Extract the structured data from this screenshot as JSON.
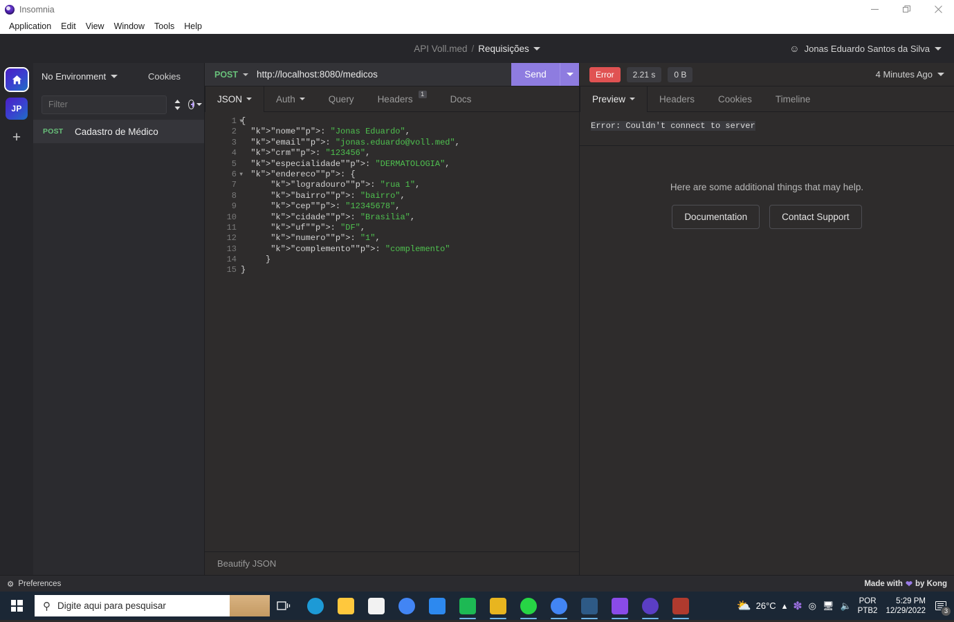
{
  "window": {
    "app_title": "Insomnia",
    "logo_icon": "insomnia-logo-icon",
    "minimize_icon": "minimize-icon",
    "maximize_icon": "maximize-icon",
    "close_icon": "close-icon"
  },
  "menubar": {
    "items": [
      {
        "label": "Application"
      },
      {
        "label": "Edit"
      },
      {
        "label": "View"
      },
      {
        "label": "Window"
      },
      {
        "label": "Tools"
      },
      {
        "label": "Help"
      }
    ]
  },
  "header": {
    "workspace": "API Voll.med",
    "separator": "/",
    "collection": "Requisições",
    "collection_caret": "chevron-down-icon",
    "account_icon": "person-icon",
    "account_name": "Jonas Eduardo Santos da Silva",
    "account_caret": "chevron-down-icon"
  },
  "rail": {
    "items": [
      {
        "label": "",
        "icon": "home-icon",
        "selected": true
      },
      {
        "label": "JP",
        "icon": "workspace-avatar",
        "selected": false
      }
    ],
    "add_label": "+"
  },
  "sidebar": {
    "environment": "No Environment",
    "environment_caret": "chevron-down-icon",
    "cookies_label": "Cookies",
    "filter_placeholder": "Filter",
    "filter_value": "",
    "sort_icon": "sort-icon",
    "add_icon": "plus-circle-icon",
    "add_caret": "chevron-down-icon",
    "requests": [
      {
        "method": "POST",
        "name": "Cadastro de Médico"
      }
    ]
  },
  "request": {
    "method": "POST",
    "method_caret": "chevron-down-icon",
    "url": "http://localhost:8080/medicos",
    "send_label": "Send",
    "send_caret": "chevron-down-icon",
    "tabs": [
      {
        "label": "JSON",
        "active": true,
        "caret": "chevron-down-icon",
        "badge": ""
      },
      {
        "label": "Auth",
        "active": false,
        "caret": "chevron-down-icon",
        "badge": ""
      },
      {
        "label": "Query",
        "active": false,
        "caret": "",
        "badge": ""
      },
      {
        "label": "Headers",
        "active": false,
        "caret": "",
        "badge": "1"
      },
      {
        "label": "Docs",
        "active": false,
        "caret": "",
        "badge": ""
      }
    ],
    "body_lines": [
      {
        "n": "1",
        "fold": true,
        "text": "{"
      },
      {
        "n": "2",
        "fold": false,
        "text": "  \"nome\": \"Jonas Eduardo\","
      },
      {
        "n": "3",
        "fold": false,
        "text": "  \"email\": \"jonas.eduardo@voll.med\","
      },
      {
        "n": "4",
        "fold": false,
        "text": "  \"crm\": \"123456\","
      },
      {
        "n": "5",
        "fold": false,
        "text": "  \"especialidade\": \"DERMATOLOGIA\","
      },
      {
        "n": "6",
        "fold": true,
        "text": "  \"endereco\": {"
      },
      {
        "n": "7",
        "fold": false,
        "text": "      \"logradouro\": \"rua 1\","
      },
      {
        "n": "8",
        "fold": false,
        "text": "      \"bairro\": \"bairro\","
      },
      {
        "n": "9",
        "fold": false,
        "text": "      \"cep\": \"12345678\","
      },
      {
        "n": "10",
        "fold": false,
        "text": "      \"cidade\": \"Brasilia\","
      },
      {
        "n": "11",
        "fold": false,
        "text": "      \"uf\": \"DF\","
      },
      {
        "n": "12",
        "fold": false,
        "text": "      \"numero\": \"1\","
      },
      {
        "n": "13",
        "fold": false,
        "text": "      \"complemento\": \"complemento\""
      },
      {
        "n": "14",
        "fold": false,
        "text": "     }"
      },
      {
        "n": "15",
        "fold": false,
        "text": "}"
      }
    ],
    "beautify_label": "Beautify JSON"
  },
  "response": {
    "status_label": "Error",
    "duration": "2.21 s",
    "size": "0 B",
    "timestamp": "4 Minutes Ago",
    "timestamp_caret": "chevron-down-icon",
    "tabs": [
      {
        "label": "Preview",
        "active": true,
        "caret": "chevron-down-icon"
      },
      {
        "label": "Headers",
        "active": false,
        "caret": ""
      },
      {
        "label": "Cookies",
        "active": false,
        "caret": ""
      },
      {
        "label": "Timeline",
        "active": false,
        "caret": ""
      }
    ],
    "error_message": "Error: Couldn't connect to server",
    "help_text": "Here are some additional things that may help.",
    "help_buttons": [
      {
        "label": "Documentation"
      },
      {
        "label": "Contact Support"
      }
    ]
  },
  "statusbar": {
    "preferences_label": "Preferences",
    "preferences_icon": "gear-icon",
    "made_with_prefix": "Made with",
    "heart_icon": "heart-icon",
    "made_with_suffix": "by Kong"
  },
  "taskbar": {
    "start_icon": "windows-start-icon",
    "search_icon": "search-icon",
    "search_placeholder": "Digite aqui para pesquisar",
    "task_view_icon": "task-view-icon",
    "apps": [
      {
        "name": "microsoft-edge-icon",
        "color": "#1d9ad6",
        "open": false
      },
      {
        "name": "file-explorer-icon",
        "color": "#ffc83d",
        "open": false
      },
      {
        "name": "microsoft-store-icon",
        "color": "#f2f2f2",
        "open": false
      },
      {
        "name": "google-chrome-icon",
        "color": "#4285f4",
        "open": false
      },
      {
        "name": "mail-icon",
        "color": "#2d89ef",
        "open": false
      },
      {
        "name": "spotify-icon",
        "color": "#1db954",
        "open": true
      },
      {
        "name": "chart-app-icon",
        "color": "#e8b51f",
        "open": true
      },
      {
        "name": "green-circle-app-icon",
        "color": "#27d545",
        "open": true
      },
      {
        "name": "google-chrome-icon",
        "color": "#4285f4",
        "open": true
      },
      {
        "name": "pen-tool-icon",
        "color": "#2e5a86",
        "open": true
      },
      {
        "name": "intellij-idea-icon",
        "color": "#8a4be8",
        "open": true
      },
      {
        "name": "insomnia-icon",
        "color": "#5b3ec4",
        "open": true
      },
      {
        "name": "winrar-icon",
        "color": "#b03a2e",
        "open": true
      }
    ],
    "tray": {
      "weather_icon": "weather-sun-cloud-icon",
      "temperature": "26°C",
      "overflow_icon": "chevron-up-icon",
      "feather_icon": "feather-icon",
      "meet_icon": "camera-icon",
      "network_icon": "network-icon",
      "volume_icon": "volume-icon",
      "language_line1": "POR",
      "language_line2": "PTB2",
      "time": "5:29 PM",
      "date": "12/29/2022",
      "notification_icon": "notification-icon",
      "notification_count": "3"
    }
  }
}
